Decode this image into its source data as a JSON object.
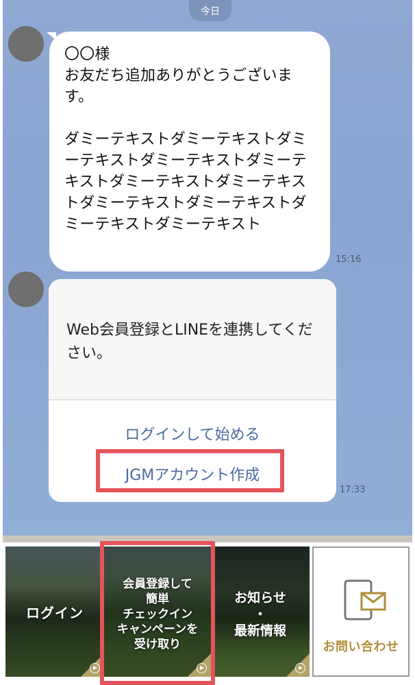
{
  "date_label": "今日",
  "messages": [
    {
      "text": "〇〇様\nお友だち追加ありがとうございます。\n\nダミーテキストダミーテキストダミーテキストダミーテキストダミーテキストダミーテキストダミーテキストダミーテキストダミーテキストダミーテキストダミーテキスト",
      "time": "15:16"
    }
  ],
  "card": {
    "body": "Web会員登録とLINEを連携してください。",
    "action_login": "ログインして始める",
    "action_create": "JGMアカウント作成",
    "time": "17:33"
  },
  "rich_menu": {
    "items": [
      {
        "label": "ログイン"
      },
      {
        "label": "会員登録して\n簡単\nチェックイン\nキャンペーンを\n受け取り"
      },
      {
        "label": "お知らせ\n・\n最新情報"
      },
      {
        "label": "お問い合わせ",
        "icon": "tablet-mail-icon"
      }
    ]
  },
  "colors": {
    "chat_bg": "#8fa9d3",
    "link": "#4b6aa0",
    "highlight": "#e5545b",
    "gold": "#b08e3a"
  }
}
